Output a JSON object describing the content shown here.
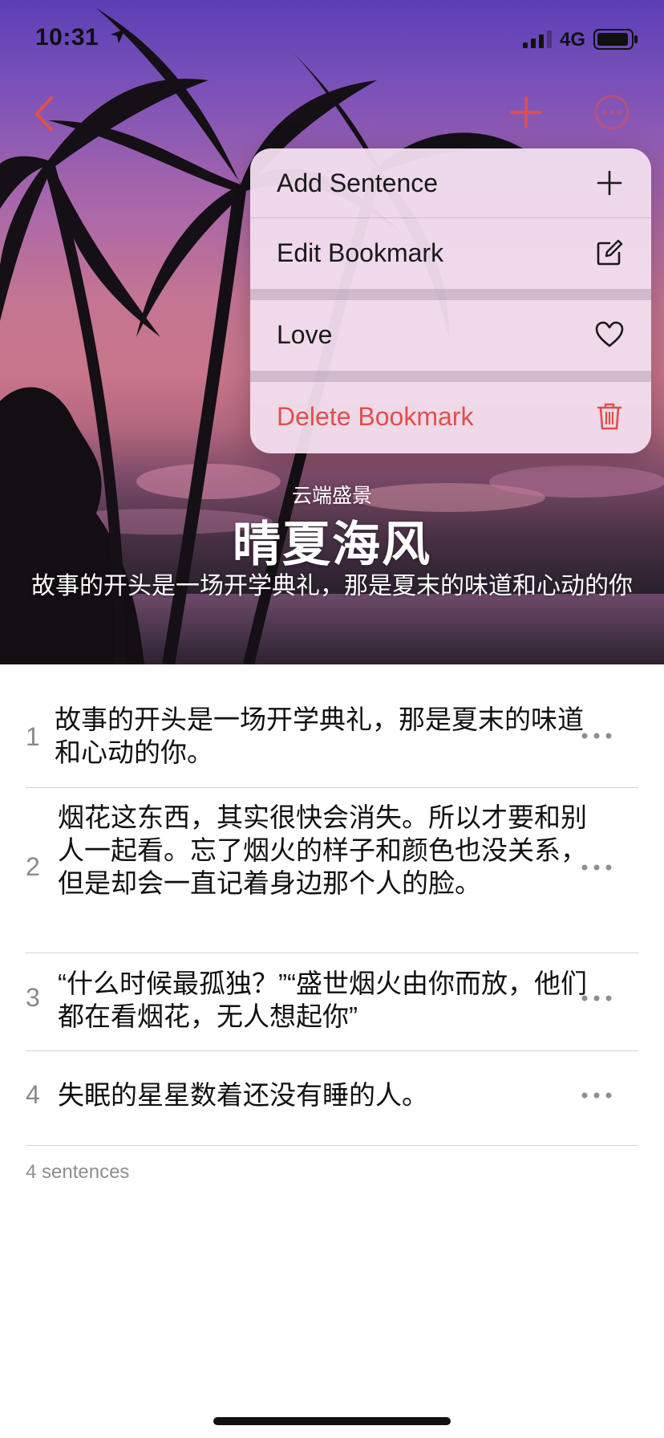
{
  "status_bar": {
    "time": "10:31",
    "network": "4G"
  },
  "nav": {
    "back_icon": "chevron-left-icon",
    "add_icon": "plus-icon",
    "more_icon": "ellipsis-circle-icon",
    "accent_color": "#e0504a"
  },
  "hero": {
    "subtitle": "云端盛景",
    "title": "晴夏海风",
    "description": "故事的开头是一场开学典礼，那是夏末的味道和心动的你"
  },
  "context_menu": {
    "items": [
      {
        "label": "Add Sentence",
        "icon": "plus-icon"
      },
      {
        "label": "Edit Bookmark",
        "icon": "edit-square-icon"
      },
      {
        "label": "Love",
        "icon": "heart-icon"
      },
      {
        "label": "Delete Bookmark",
        "icon": "trash-icon",
        "color": "#e0504a"
      }
    ]
  },
  "sentences": [
    {
      "number": "1",
      "text": "故事的开头是一场开学典礼，那是夏末的味道和心动的你。"
    },
    {
      "number": "2",
      "text": "烟花这东西，其实很快会消失。所以才要和别人一起看。忘了烟火的样子和颜色也没关系，但是却会一直记着身边那个人的脸。"
    },
    {
      "number": "3",
      "text": "“什么时候最孤独？”“盛世烟火由你而放，他们都在看烟花，无人想起你”"
    },
    {
      "number": "4",
      "text": "失眠的星星数着还没有睡的人。"
    }
  ],
  "footer": {
    "count_label": "4 sentences"
  }
}
